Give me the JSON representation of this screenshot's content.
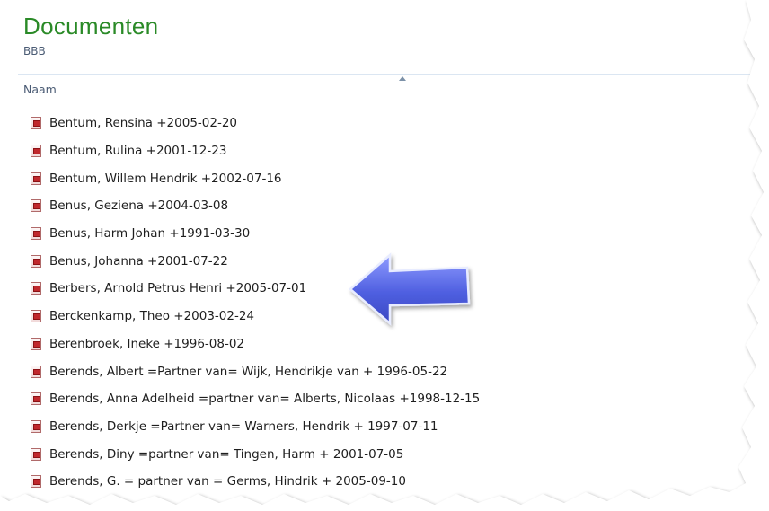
{
  "library": {
    "title": "Documenten",
    "subtitle": "BBB"
  },
  "column_header": "Naam",
  "files": [
    {
      "name": "Bentum, Rensina +2005-02-20",
      "icon": "pdf-icon"
    },
    {
      "name": "Bentum, Rulina +2001-12-23",
      "icon": "pdf-icon"
    },
    {
      "name": "Bentum, Willem Hendrik +2002-07-16",
      "icon": "pdf-icon"
    },
    {
      "name": "Benus, Geziena +2004-03-08",
      "icon": "pdf-icon"
    },
    {
      "name": "Benus, Harm Johan +1991-03-30",
      "icon": "pdf-icon"
    },
    {
      "name": "Benus, Johanna +2001-07-22",
      "icon": "pdf-icon"
    },
    {
      "name": "Berbers, Arnold Petrus Henri +2005-07-01",
      "icon": "pdf-icon"
    },
    {
      "name": "Berckenkamp, Theo +2003-02-24",
      "icon": "pdf-icon"
    },
    {
      "name": "Berenbroek, Ineke +1996-08-02",
      "icon": "pdf-icon"
    },
    {
      "name": "Berends, Albert =Partner van= Wijk, Hendrikje van + 1996-05-22",
      "icon": "pdf-icon"
    },
    {
      "name": "Berends, Anna Adelheid =partner van= Alberts, Nicolaas +1998-12-15",
      "icon": "pdf-icon"
    },
    {
      "name": "Berends, Derkje =Partner van= Warners, Hendrik + 1997-07-11",
      "icon": "pdf-icon"
    },
    {
      "name": "Berends, Diny =partner van= Tingen, Harm + 2001-07-05",
      "icon": "pdf-icon"
    },
    {
      "name": "Berends, G. = partner van = Germs, Hindrik + 2005-09-10",
      "icon": "pdf-icon"
    }
  ],
  "colors": {
    "title_green": "#2a8a27",
    "arrow_blue": "#4f5fe0"
  }
}
